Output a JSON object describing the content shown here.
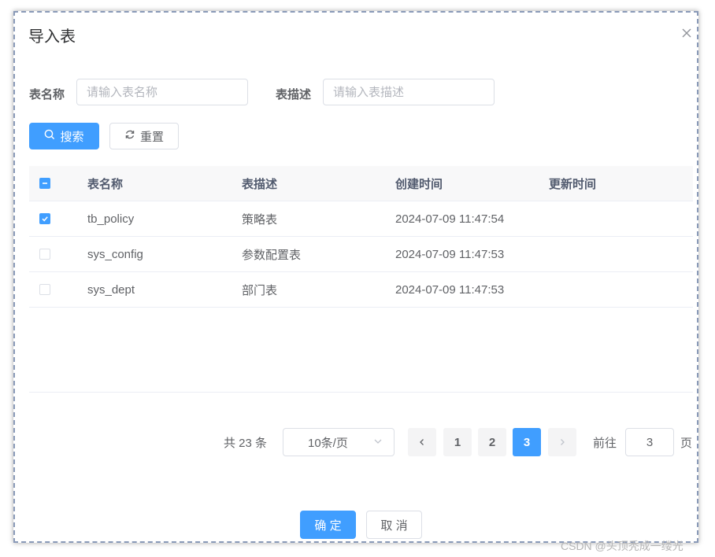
{
  "dialog": {
    "title": "导入表"
  },
  "search": {
    "table_name_label": "表名称",
    "table_name_placeholder": "请输入表名称",
    "table_desc_label": "表描述",
    "table_desc_placeholder": "请输入表描述",
    "search_label": "搜索",
    "reset_label": "重置"
  },
  "table": {
    "headers": [
      "表名称",
      "表描述",
      "创建时间",
      "更新时间"
    ],
    "rows": [
      {
        "checked": true,
        "name": "tb_policy",
        "desc": "策略表",
        "created": "2024-07-09 11:47:54",
        "updated": ""
      },
      {
        "checked": false,
        "name": "sys_config",
        "desc": "参数配置表",
        "created": "2024-07-09 11:47:53",
        "updated": ""
      },
      {
        "checked": false,
        "name": "sys_dept",
        "desc": "部门表",
        "created": "2024-07-09 11:47:53",
        "updated": ""
      }
    ]
  },
  "pagination": {
    "total_text": "共 23 条",
    "page_size": "10条/页",
    "pages": [
      "1",
      "2",
      "3"
    ],
    "current_page": "3",
    "goto_prefix": "前往",
    "goto_value": "3",
    "goto_suffix": "页"
  },
  "footer": {
    "confirm_label": "确 定",
    "cancel_label": "取 消"
  },
  "watermark": "CSDN @头顶秃成一缕光",
  "colors": {
    "primary": "#409eff",
    "border": "#dcdfe6",
    "header_bg": "#f8f8f9"
  }
}
